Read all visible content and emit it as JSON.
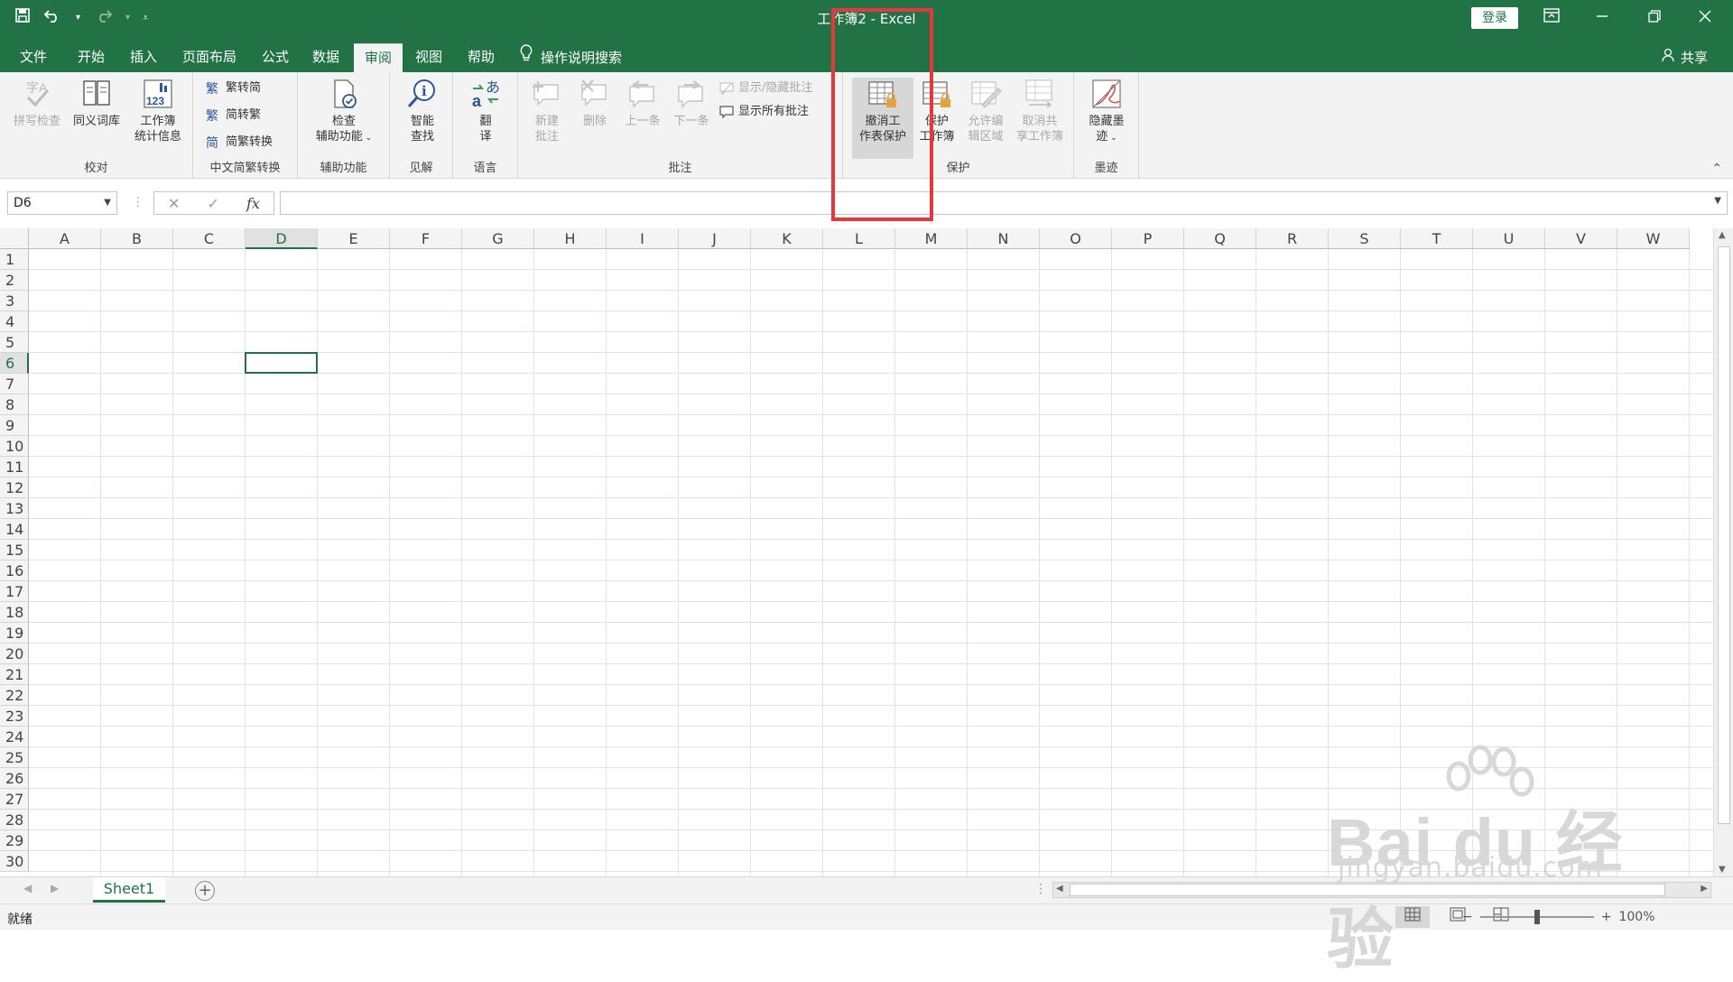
{
  "app": {
    "title": "工作簿2  -  Excel",
    "login_label": "登录"
  },
  "qat": {
    "save_icon": "save-icon",
    "undo_icon": "undo-icon",
    "redo_icon": "redo-icon",
    "customize_icon": "customize-icon"
  },
  "tabs": [
    {
      "label": "文件"
    },
    {
      "label": "开始"
    },
    {
      "label": "插入"
    },
    {
      "label": "页面布局"
    },
    {
      "label": "公式"
    },
    {
      "label": "数据"
    },
    {
      "label": "审阅"
    },
    {
      "label": "视图"
    },
    {
      "label": "帮助"
    }
  ],
  "tell_me": "操作说明搜索",
  "share_label": "共享",
  "ribbon": {
    "proofing": {
      "label": "校对",
      "spelling": "拼写检查",
      "thesaurus": "同义词库",
      "stats_line1": "工作簿",
      "stats_line2": "统计信息"
    },
    "chinese": {
      "label": "中文简繁转换",
      "to_simplified": "繁转简",
      "to_traditional": "简转繁",
      "convert": "简繁转换"
    },
    "accessibility": {
      "label": "辅助功能",
      "check_line1": "检查",
      "check_line2": "辅助功能"
    },
    "insights": {
      "label": "见解",
      "smart_line1": "智能",
      "smart_line2": "查找"
    },
    "language": {
      "label": "语言",
      "translate_line1": "翻",
      "translate_line2": "译"
    },
    "comments": {
      "label": "批注",
      "new_line1": "新建",
      "new_line2": "批注",
      "delete": "删除",
      "previous": "上一条",
      "next": "下一条",
      "show_hide": "显示/隐藏批注",
      "show_all": "显示所有批注"
    },
    "protect": {
      "label": "保护",
      "unprotect_line1": "撤消工",
      "unprotect_line2": "作表保护",
      "protect_wb_line1": "保护",
      "protect_wb_line2": "工作簿",
      "allow_edit_line1": "允许编",
      "allow_edit_line2": "辑区域",
      "unshare_line1": "取消共",
      "unshare_line2": "享工作簿"
    },
    "ink": {
      "label": "墨迹",
      "hide_line1": "隐藏墨",
      "hide_line2": "迹"
    }
  },
  "formula_bar": {
    "name_box": "D6",
    "fx": "fx",
    "value": ""
  },
  "grid": {
    "columns": [
      "A",
      "B",
      "C",
      "D",
      "E",
      "F",
      "G",
      "H",
      "I",
      "J",
      "K",
      "L",
      "M",
      "N",
      "O",
      "P",
      "Q",
      "R",
      "S",
      "T",
      "U",
      "V",
      "W"
    ],
    "rows": [
      "1",
      "2",
      "3",
      "4",
      "5",
      "6",
      "7",
      "8",
      "9",
      "10",
      "11",
      "12",
      "13",
      "14",
      "15",
      "16",
      "17",
      "18",
      "19",
      "20",
      "21",
      "22",
      "23",
      "24",
      "25",
      "26",
      "27",
      "28",
      "29",
      "30"
    ],
    "selected_column": "D",
    "selected_row": "6"
  },
  "sheets": {
    "active": "Sheet1"
  },
  "status": {
    "ready": "就绪",
    "zoom": "100%"
  },
  "watermark": {
    "brand": "Bai du 经验",
    "url": "jingyan.baidu.com"
  },
  "colors": {
    "excel_green": "#217346",
    "highlight_red": "#e8363d"
  }
}
